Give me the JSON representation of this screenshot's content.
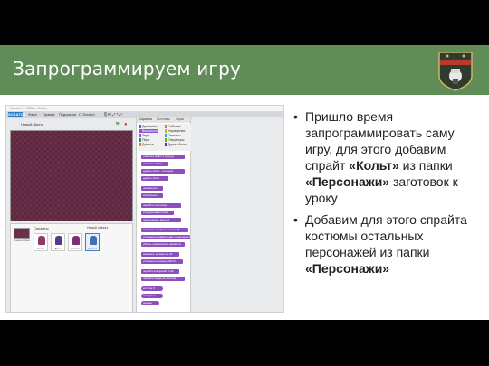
{
  "slide": {
    "title": "Запрограммируем игру"
  },
  "scratch": {
    "browser_tab": "Scratch 2 Offline Editor",
    "logo": "SCRATCH",
    "menu": [
      "Файл",
      "Правка",
      "Подсказки",
      "О Scratch"
    ],
    "stage_title": "Новый Шахта",
    "sprites_header": "Спрайты",
    "new_sprite_label": "Новый объект:",
    "stage_label": "Сцена\n1 фон",
    "sprites": [
      {
        "name": "Кольт",
        "color": "#8e3c6b",
        "selected": false
      },
      {
        "name": "Брок",
        "color": "#5a3a8a",
        "selected": false
      },
      {
        "name": "Шелли",
        "color": "#7b2f6e",
        "selected": false
      },
      {
        "name": "Кольт2",
        "color": "#3f6fb5",
        "selected": true
      }
    ],
    "tabs": [
      "Скрипты",
      "Костюмы",
      "Звуки"
    ],
    "categories_left": [
      "Движение",
      "Внешность",
      "Звук",
      "Перо",
      "Данные"
    ],
    "categories_right": [
      "События",
      "Управление",
      "Сенсоры",
      "Операторы",
      "Другие блоки"
    ],
    "category_colors": {
      "motion": "#4a6cd4",
      "looks": "#8a55d7",
      "sound": "#bb42c3",
      "pen": "#0e9a6c",
      "data": "#ee7d16",
      "events": "#c88330",
      "control": "#e1a91a",
      "sensing": "#2ca5e2",
      "operators": "#5cb712",
      "more": "#632d99"
    },
    "blocks": [
      "говорить Hello! 2 секунд",
      "говорить Hello!",
      "думать Hmm... 2 секунд",
      "думать Hmm...",
      "показаться",
      "спрятаться",
      "перейти к костюму",
      "следующий костюм",
      "переключить фон на",
      "изменить эффект цвет на 25",
      "установить эффект цвет в значение 0",
      "убрать графические эффекты",
      "изменить размер на 10",
      "установить размер 100 %",
      "перейти в верхний слой",
      "перейти назад на 1 слоев",
      "костюм #",
      "имя фона",
      "размер"
    ]
  },
  "bullets": [
    {
      "parts": [
        "Пришло время запрограммировать саму игру, для этого добавим спрайт ",
        "«Кольт»",
        " из папки ",
        "«Персонажи»",
        " заготовок к уроку"
      ]
    },
    {
      "parts": [
        "Добавим для этого спрайта костюмы остальных персонажей из папки ",
        "«Персонажи»",
        "",
        "",
        ""
      ]
    }
  ]
}
